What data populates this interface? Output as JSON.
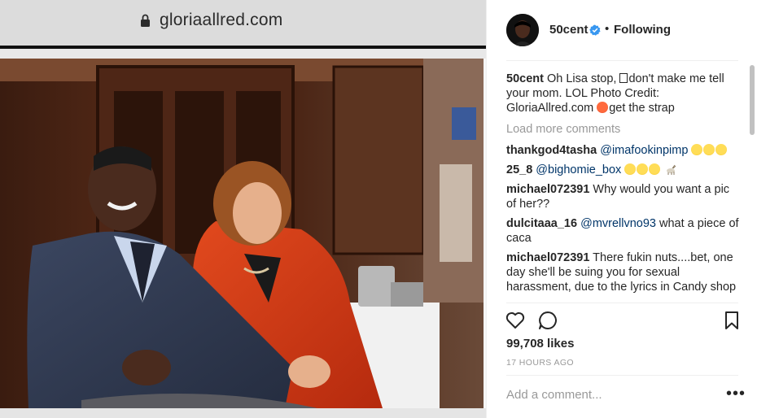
{
  "browser": {
    "url": "gloriaallred.com"
  },
  "photo": {
    "alt": ""
  },
  "post": {
    "username": "50cent",
    "following_label": "Following",
    "separator": "•",
    "caption": {
      "user": "50cent",
      "text_before_box": "Oh Lisa stop, ",
      "text_after_box": "don't make me tell your mom. LOL Photo Credit: GloriaAllred.com ",
      "text_after_emoji": "get the strap"
    },
    "load_more": "Load more comments",
    "comments": [
      {
        "user": "thankgod4tasha",
        "mention": "@imafookinpimp",
        "text": ""
      },
      {
        "user": "25_8",
        "mention": "@bighomie_box",
        "text": ""
      },
      {
        "user": "michael072391",
        "mention": "",
        "text": "Why would you want a pic of her??"
      },
      {
        "user": "dulcitaaa_16",
        "mention": "@mvrellvno93",
        "text": "what a piece of caca"
      },
      {
        "user": "michael072391",
        "mention": "",
        "text": "There fukin nuts....bet, one day she'll be suing you for sexual harassment, due to the lyrics in Candy shop"
      }
    ],
    "likes": "99,708 likes",
    "time_ago": "17 HOURS AGO",
    "add_comment_placeholder": "Add a comment...",
    "more_label": "•••"
  },
  "icons": {
    "lock": "lock-icon",
    "verified": "verified-badge-icon",
    "heart": "heart-icon",
    "comment": "comment-icon",
    "bookmark": "bookmark-icon",
    "more": "more-options-icon"
  },
  "colors": {
    "accent": "#3897f0",
    "mention": "#003569",
    "muted": "#999999",
    "text": "#262626"
  }
}
